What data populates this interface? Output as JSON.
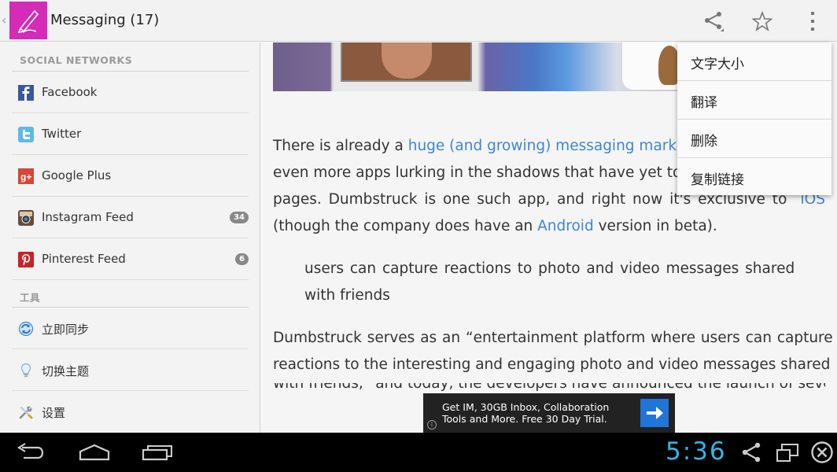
{
  "actionbar": {
    "title": "Messaging (17)",
    "up_caret": "‹",
    "icons": [
      "pen-icon",
      "share-icon",
      "star-icon",
      "overflow-icon"
    ]
  },
  "sidebar": {
    "section_social": "SOCIAL NETWORKS",
    "social_items": [
      {
        "label": "Facebook",
        "icon": "facebook-icon",
        "color": "#3b5998"
      },
      {
        "label": "Twitter",
        "icon": "twitter-icon",
        "color": "#5fb9e8"
      },
      {
        "label": "Google Plus",
        "icon": "google-plus-icon",
        "color": "#d34836"
      },
      {
        "label": "Instagram Feed",
        "icon": "instagram-icon",
        "badge": "34"
      },
      {
        "label": "Pinterest Feed",
        "icon": "pinterest-icon",
        "color": "#cb2027",
        "badge": "6"
      }
    ],
    "section_tools": "工具",
    "tool_items": [
      {
        "label": "立即同步",
        "icon": "sync-icon"
      },
      {
        "label": "切换主题",
        "icon": "lightbulb-icon"
      },
      {
        "label": "设置",
        "icon": "settings-icon"
      }
    ]
  },
  "article": {
    "p1_l1_a": "There is already a ",
    "p1_l1_link": "huge (and growing) messaging mark",
    "p1_l2": "even more apps lurking in the shadows that have yet to",
    "p1_l3_a": "pages. Dumbstruck is one such app, and right now it's exclusive to",
    "p1_l3_link": "iOS",
    "p1_l4_a": "(though the company does have an ",
    "p1_l4_link": "Android",
    "p1_l4_b": " version in beta).",
    "quote_l1": "users can capture reactions to photo and video messages shared",
    "quote_l2": "with friends",
    "p2_l1": "Dumbstruck serves as an “entertainment platform where users can capture",
    "p2_l2": "reactions to the interesting and engaging photo and video messages shared",
    "p2_l3": "with friends,” and today, the developers have announced the launch of several"
  },
  "menu": {
    "items": [
      "文字大小",
      "翻译",
      "删除",
      "复制链接"
    ]
  },
  "ad": {
    "text": "Get IM, 30GB Inbox, Collaboration Tools and More. Free 30 Day Trial.",
    "info": "i"
  },
  "system": {
    "clock": "5:36"
  },
  "colors": {
    "accent": "#33b5e5",
    "link": "#3f85d4",
    "app_icon": "#d42bb8"
  }
}
